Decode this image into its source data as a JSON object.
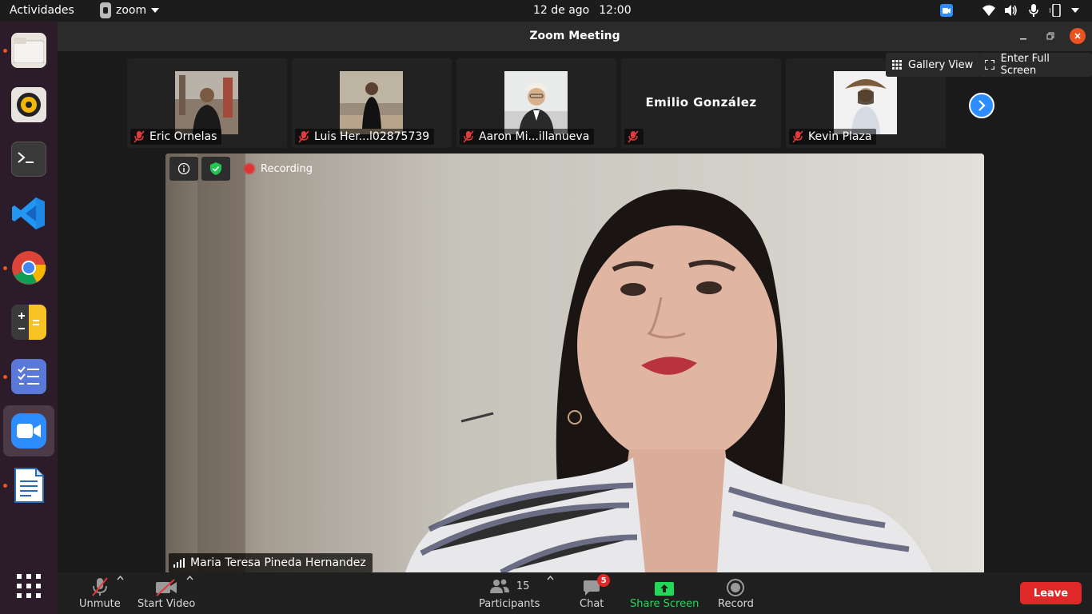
{
  "topbar": {
    "activities": "Actividades",
    "app_name": "zoom",
    "date": "12 de ago",
    "time": "12:00"
  },
  "dock": {
    "items": [
      {
        "name": "files",
        "running": true
      },
      {
        "name": "rhythmbox",
        "running": false
      },
      {
        "name": "terminal",
        "running": false
      },
      {
        "name": "vscode",
        "running": false
      },
      {
        "name": "chrome",
        "running": true
      },
      {
        "name": "calculator",
        "running": false
      },
      {
        "name": "tasks",
        "running": true
      },
      {
        "name": "zoom",
        "running": true,
        "active": true
      },
      {
        "name": "libreoffice-writer",
        "running": true
      }
    ]
  },
  "window": {
    "title": "Zoom Meeting",
    "gallery_view_label": "Gallery View",
    "full_screen_label": "Enter Full Screen"
  },
  "participants": [
    {
      "name": "Eric Ornelas",
      "muted": true,
      "has_photo": true
    },
    {
      "name": "Luis Her...l02875739",
      "muted": true,
      "has_photo": true
    },
    {
      "name": "Aaron Mi...illanueva",
      "muted": true,
      "has_photo": true
    },
    {
      "name": "",
      "big_name": "Emilio González",
      "muted": true,
      "has_photo": false
    },
    {
      "name": "Kevin Plaza",
      "muted": true,
      "has_photo": true
    }
  ],
  "main_video": {
    "recording_label": "Recording",
    "speaker_name": "Maria Teresa Pineda Hernandez"
  },
  "toolbar": {
    "unmute_label": "Unmute",
    "start_video_label": "Start Video",
    "participants_label": "Participants",
    "participants_count": "15",
    "chat_label": "Chat",
    "chat_badge": "5",
    "share_screen_label": "Share Screen",
    "record_label": "Record",
    "leave_label": "Leave"
  },
  "colors": {
    "accent_blue": "#2d8cff",
    "share_green": "#23d959",
    "leave_red": "#e02828",
    "ubuntu_orange": "#e95420"
  }
}
